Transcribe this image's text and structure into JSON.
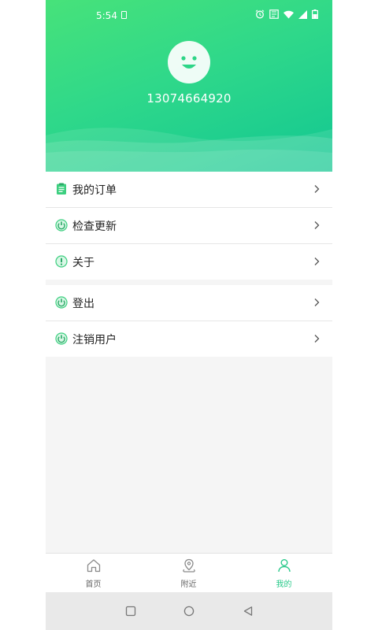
{
  "status_bar": {
    "time": "5:54"
  },
  "profile": {
    "phone": "13074664920"
  },
  "menu": {
    "group1": [
      {
        "label": "我的订单",
        "icon": "order-list-icon"
      },
      {
        "label": "检查更新",
        "icon": "power-icon"
      },
      {
        "label": "关于",
        "icon": "info-icon"
      }
    ],
    "group2": [
      {
        "label": "登出",
        "icon": "power-icon"
      },
      {
        "label": "注销用户",
        "icon": "power-icon"
      }
    ]
  },
  "bottom_nav": {
    "items": [
      {
        "label": "首页",
        "icon": "home-icon",
        "active": false
      },
      {
        "label": "附近",
        "icon": "map-pin-icon",
        "active": false
      },
      {
        "label": "我的",
        "icon": "person-icon",
        "active": true
      }
    ]
  },
  "colors": {
    "accent": "#28c98a",
    "header_gradient_start": "#47e27a",
    "header_gradient_end": "#12c792",
    "background": "#f5f5f5"
  }
}
